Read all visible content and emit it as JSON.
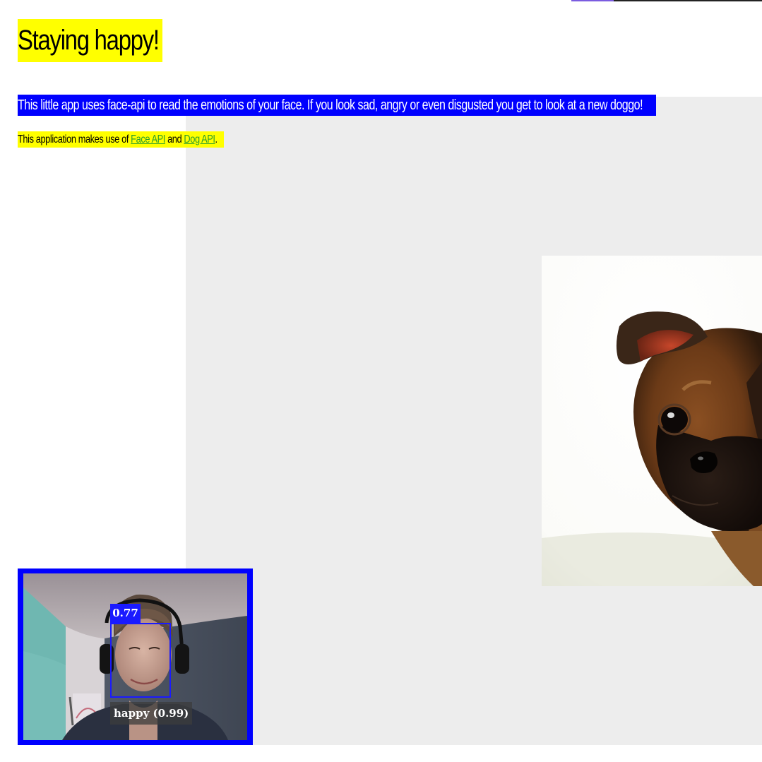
{
  "header": {
    "title": "Staying happy!"
  },
  "intro": {
    "description": "This little app uses face-api to read the emotions of your face. If you look sad, angry or even disgusted you get to look at a new doggo!",
    "credits_prefix": "This application makes use of ",
    "face_api_link": "Face API",
    "credits_and": " and ",
    "dog_api_link": "Dog API",
    "credits_suffix": "."
  },
  "webcam": {
    "detection_score": "0.77",
    "expression_label": "happy (0.99)"
  },
  "colors": {
    "title_highlight": "#ffff00",
    "description_highlight": "#0000ff",
    "webcam_border": "#0000ff",
    "page_panel": "#ededed",
    "link": "#2a9d2a"
  }
}
